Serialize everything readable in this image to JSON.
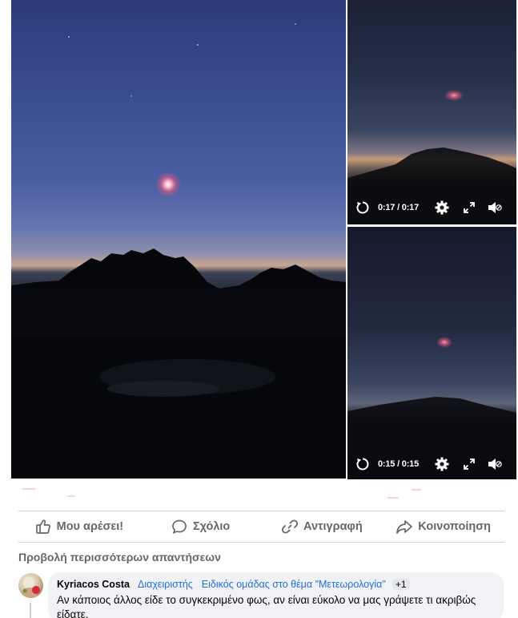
{
  "videos": [
    {
      "time": "0:17 / 0:17"
    },
    {
      "time": "0:15 / 0:15"
    }
  ],
  "icons": {
    "replay": "replay-icon",
    "settings": "gear-icon",
    "fullscreen": "expand-icon",
    "volume": "volume-muted-icon"
  },
  "actions": {
    "like": "Μου αρέσει!",
    "comment": "Σχόλιο",
    "copy": "Αντιγραφή",
    "share": "Κοινοποίηση"
  },
  "more_replies": "Προβολή περισσότερων απαντήσεων",
  "comment": {
    "author": "Kyriacos Costa",
    "role": "Διαχειριστής",
    "expert": "Ειδικός ομάδας στο θέμα \"Μετεωρολογία\"",
    "badge_count": "+1",
    "text": "Αν κάποιος άλλος είδε το συγκεκριμένο φως, αν είναι εύκολο να μας γράψετε τι ακριβώς είδατε."
  },
  "colors": {
    "link_blue": "#216fdb",
    "muted_text": "#65676b",
    "bubble_bg": "#f0f2f5",
    "divider": "#ced0d4"
  }
}
